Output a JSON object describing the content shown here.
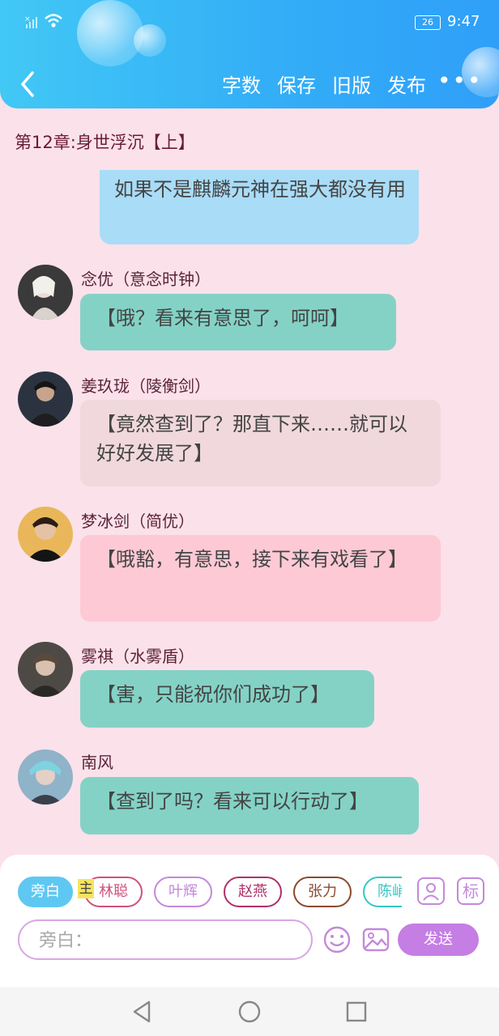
{
  "status": {
    "signal": "×",
    "battery": "26",
    "time": "9:47"
  },
  "header": {
    "actions": [
      "字数",
      "保存",
      "旧版",
      "发布"
    ],
    "more": "•••"
  },
  "chapter_title": "第12章:身世浮沉【上】",
  "top_message": "如果不是麒麟元神在强大都没有用",
  "messages": [
    {
      "name": "念优（意念时钟）",
      "text": "【哦？看来有意思了，呵呵】",
      "color": "teal"
    },
    {
      "name": "姜玖珑（陵衡剑）",
      "text": "【竟然查到了？那直下来……就可以好好发展了】",
      "color": "gray"
    },
    {
      "name": "梦冰剑（简优）",
      "text": "【哦豁，有意思，接下来有戏看了】",
      "color": "pink"
    },
    {
      "name": "雾祺（水雾盾）",
      "text": "【害，只能祝你们成功了】",
      "color": "teal"
    },
    {
      "name": "南风",
      "text": "【查到了吗？看来可以行动了】",
      "color": "teal"
    }
  ],
  "characters": {
    "narrator": "旁白",
    "host_tag": "主",
    "chips": [
      "林聪",
      "叶辉",
      "赵燕",
      "张力",
      "陈峭"
    ]
  },
  "chip_colors": [
    "#d0517d",
    "#c389db",
    "#b0306a",
    "#8a4a2c",
    "#35c7c6"
  ],
  "tools": {
    "person_icon": "person-icon",
    "mark": "标"
  },
  "composer": {
    "placeholder": "旁白：",
    "send": "发送"
  }
}
